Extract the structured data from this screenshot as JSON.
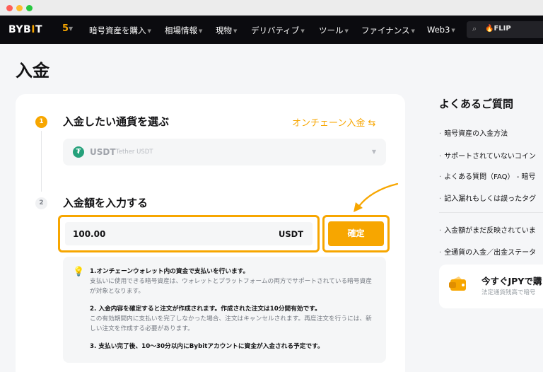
{
  "nav": {
    "logo_left": "BYB",
    "logo_bar": "I",
    "logo_right": "T",
    "promo_glyph": "5",
    "items": [
      "暗号資産を購入",
      "相場情報",
      "現物",
      "デリバティブ",
      "ツール",
      "ファイナンス",
      "Web3"
    ],
    "search_placeholder": "🔥FLIP"
  },
  "page_title": "入金",
  "steps": [
    {
      "number": "1",
      "title": "入金したい通貨を選ぶ"
    },
    {
      "number": "2",
      "title": "入金額を入力する"
    }
  ],
  "onchain_link": "オンチェーン入金 ⇆",
  "coin": {
    "icon": "₮",
    "code": "USDT",
    "name": "Tether USDT"
  },
  "amount": {
    "value": "100.00",
    "unit": "USDT"
  },
  "confirm_label": "確定",
  "notes": [
    {
      "head": "1.オンチェーンウォレット内の資金で支払いを行います。",
      "body": "支払いに使用できる暗号資産は、ウォレットとプラットフォームの両方でサポートされている暗号資産が対象となります。"
    },
    {
      "head": "2. 入金内容を確定すると注文が作成されます。作成された注文は10分間有効です。",
      "body": "この有効期間内に支払いを完了しなかった場合、注文はキャンセルされます。再度注文を行うには、新しい注文を作成する必要があります。"
    },
    {
      "head": "3. 支払い完了後、10～30分以内にBybitアカウントに資金が入金される予定です。",
      "body": ""
    }
  ],
  "faq": {
    "title": "よくあるご質問",
    "items": [
      "暗号資産の入金方法",
      "サポートされていないコイン",
      "よくある質問（FAQ） - 暗号",
      "記入漏れもしくは誤ったタグ",
      "入金額がまだ反映されていま",
      "全通貨の入金／出金ステータ"
    ]
  },
  "promo_card": {
    "title": "今すぐJPYで購",
    "subtitle": "法定通貨残高で暗号"
  },
  "colors": {
    "accent": "#f7a600",
    "navbar": "#0b0b0f",
    "tether": "#26a17b"
  }
}
